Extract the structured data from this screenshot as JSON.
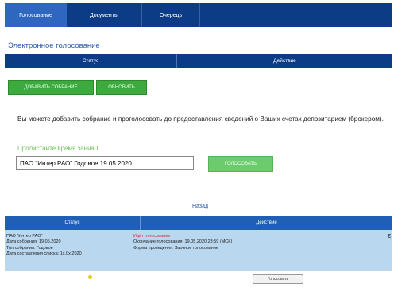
{
  "tabs": [
    {
      "label": "Голосование"
    },
    {
      "label": "Документы"
    },
    {
      "label": "Очередь"
    }
  ],
  "section_title": "Электронное голосование",
  "top_table": {
    "col_status": "Статус",
    "col_action": "Действие"
  },
  "buttons": {
    "add_meeting": "ДОБАВИТЬ СОБРАНИЕ",
    "refresh": "ОБНОВИТЬ",
    "vote": "ГОЛОСОВАТЬ"
  },
  "info_text": "Вы можете добавить собрание и проголосовать до предоставления сведений о Ваших счетах депозитарием (брокером).",
  "prompt_label": "Пролистайте время занча0",
  "meeting_input_value": "ПАО \"Интер РАО\" Годовое 19.05.2020",
  "back_link": "Назад",
  "bottom_table": {
    "col_status": "Статус",
    "col_action": "Действие",
    "row": {
      "issuer": "ПАО \"Интер РАО\"",
      "meeting_date": "Дата собрания: 19.05.2020",
      "meeting_type": "Тип собрания: Годовое",
      "list_date": "Дата составления списка: 1х.0х.2020",
      "status": "Идёт голосование",
      "deadline": "Окончание голосования: 19.05.2020 23:59 (МСК)",
      "form": "Форма проведения: Заочное голосование",
      "mark": "€"
    },
    "footer": {
      "minus": "–",
      "button": "Голосовать"
    }
  },
  "colors": {
    "nav_bg": "#0d3c87",
    "tab_active": "#2f66bf",
    "green": "#3daa3d",
    "row_bg": "#b9d7ef",
    "status_red": "#d0302a"
  }
}
